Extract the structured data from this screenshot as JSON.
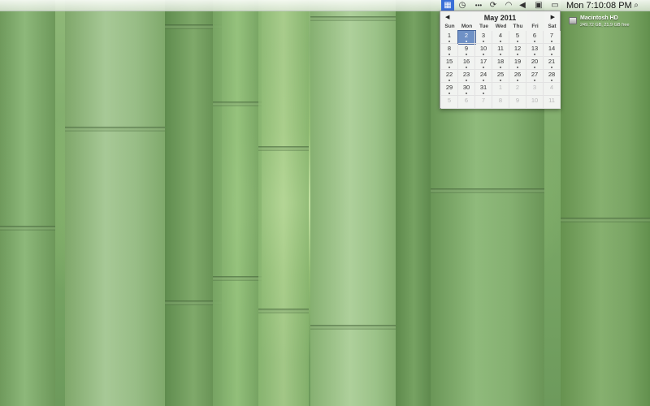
{
  "menubar": {
    "clock": "Mon 7:10:08 PM",
    "status_icons": [
      "calendar-icon",
      "time-machine-icon",
      "bluetooth-icon",
      "sync-icon",
      "wifi-icon",
      "volume-icon",
      "display-icon",
      "battery-icon",
      "spotlight-icon"
    ]
  },
  "calendar": {
    "title": "May 2011",
    "prev_label": "◀",
    "next_label": "▶",
    "weekdays": [
      "Sun",
      "Mon",
      "Tue",
      "Wed",
      "Thu",
      "Fri",
      "Sat"
    ],
    "today": 2,
    "weeks": [
      [
        "1",
        "2",
        "3",
        "4",
        "5",
        "6",
        "7"
      ],
      [
        "8",
        "9",
        "10",
        "11",
        "12",
        "13",
        "14"
      ],
      [
        "15",
        "16",
        "17",
        "18",
        "19",
        "20",
        "21"
      ],
      [
        "22",
        "23",
        "24",
        "25",
        "26",
        "27",
        "28"
      ],
      [
        "29",
        "30",
        "31",
        "1",
        "2",
        "3",
        "4"
      ],
      [
        "5",
        "6",
        "7",
        "8",
        "9",
        "10",
        "11"
      ]
    ]
  },
  "drive": {
    "name": "Macintosh HD",
    "info": "249.72 GB, 21.9 GB free"
  },
  "colors": {
    "today_highlight": "#6f91c6",
    "calendar_menu_accent": "#3a6fd8"
  }
}
